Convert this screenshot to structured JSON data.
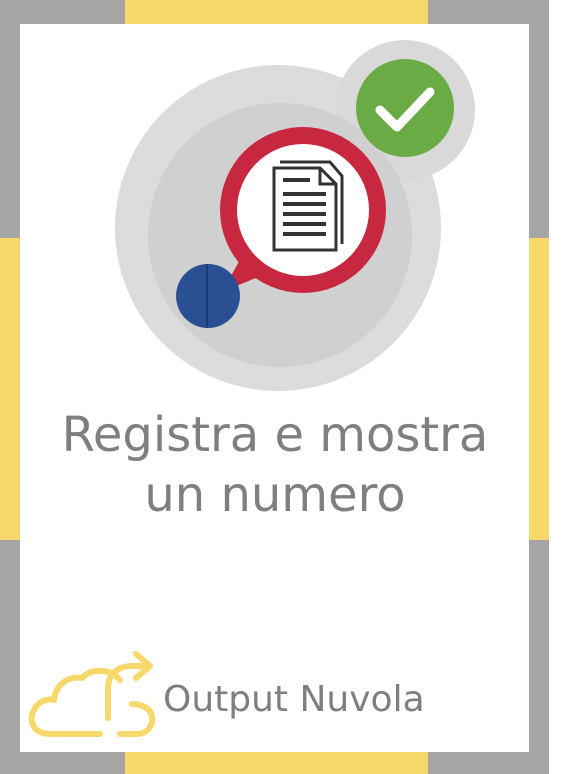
{
  "card": {
    "title_line_1": "Registra e mostra",
    "title_line_2": "un numero",
    "footer_label": "Output Nuvola"
  },
  "icons": {
    "hero": "document-with-checkmark-icon",
    "status": "checkmark-icon",
    "document": "document-icon",
    "footer": "cloud-upload-icon"
  },
  "colors": {
    "frame_gray": "#a6a6a6",
    "frame_yellow": "#f7d96b",
    "text_gray": "#7f7f7f",
    "check_green": "#6bab45",
    "bubble_red": "#c8283f",
    "dot_blue": "#2b4f93",
    "cloud_yellow": "#f7d96b"
  }
}
